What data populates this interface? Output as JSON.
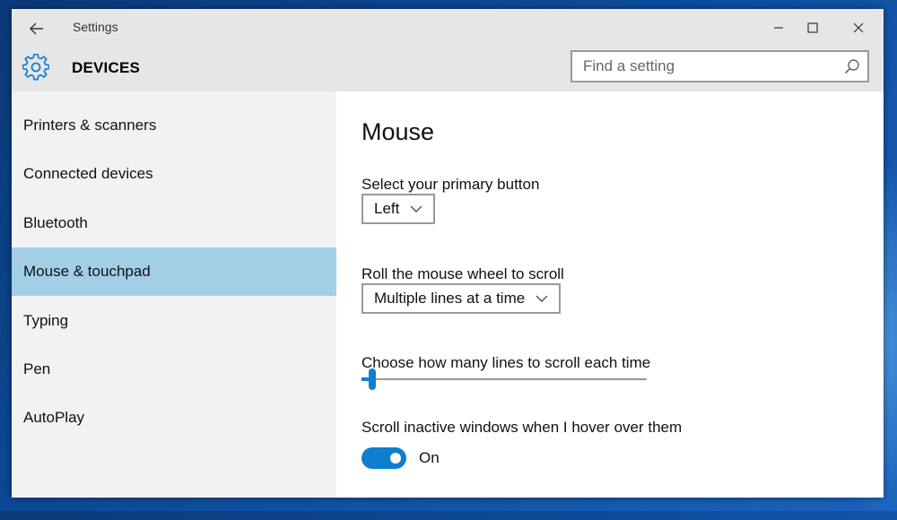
{
  "window": {
    "title": "Settings",
    "section": "DEVICES"
  },
  "search": {
    "placeholder": "Find a setting",
    "value": ""
  },
  "sidebar": {
    "items": [
      {
        "label": "Printers & scanners",
        "selected": false
      },
      {
        "label": "Connected devices",
        "selected": false
      },
      {
        "label": "Bluetooth",
        "selected": false
      },
      {
        "label": "Mouse & touchpad",
        "selected": true
      },
      {
        "label": "Typing",
        "selected": false
      },
      {
        "label": "Pen",
        "selected": false
      },
      {
        "label": "AutoPlay",
        "selected": false
      }
    ]
  },
  "main": {
    "title": "Mouse",
    "primary_button": {
      "label": "Select your primary button",
      "value": "Left"
    },
    "scroll_wheel": {
      "label": "Roll the mouse wheel to scroll",
      "value": "Multiple lines at a time"
    },
    "lines_to_scroll": {
      "label": "Choose how many lines to scroll each time",
      "level": 0.02
    },
    "scroll_inactive": {
      "label": "Scroll inactive windows when I hover over them",
      "state": "On"
    }
  },
  "colors": {
    "accent": "#0e7fd0",
    "selected_item": "#a2cfe6",
    "sidebar_bg": "#f2f2f2",
    "header_bg": "#e6e6e6"
  },
  "icons": {
    "back": "back-arrow-icon",
    "minimize": "minimize-icon",
    "maximize": "maximize-icon",
    "close": "close-icon",
    "devices": "gear-icon",
    "search": "search-icon",
    "dropdown": "chevron-down-icon"
  }
}
